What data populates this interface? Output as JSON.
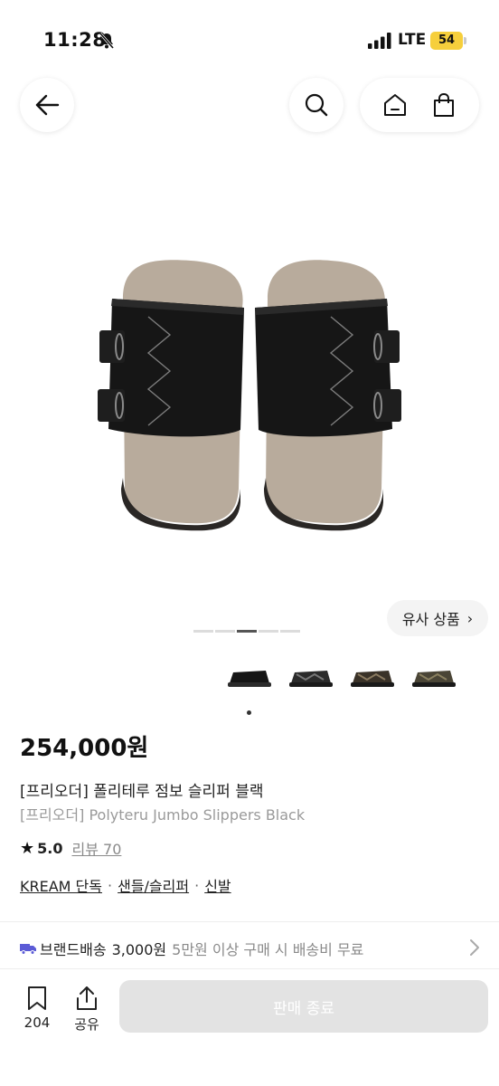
{
  "status_bar": {
    "time": "11:28",
    "network": "LTE",
    "battery": "54"
  },
  "nav": {
    "back_icon": "arrow-left-icon",
    "search_icon": "search-icon",
    "home_icon": "home-icon",
    "cart_icon": "shopping-bag-icon"
  },
  "gallery": {
    "similar_label": "유사 상품",
    "indicator_count": 5,
    "active_index": 2
  },
  "product": {
    "price": "254,000원",
    "name_ko": "[프리오더] 폴리테루 점보 슬리퍼 블랙",
    "name_en": "[프리오더] Polyteru Jumbo Slippers Black",
    "rating": "5.0",
    "review": "리뷰 70",
    "tags": [
      "KREAM 단독",
      "샌들/슬리퍼",
      "신발"
    ]
  },
  "shipping": {
    "label": "브랜드배송",
    "fee": "3,000원",
    "note": "5만원 이상 구매 시 배송비 무료"
  },
  "bottom": {
    "bookmark_count": "204",
    "share_label": "공유",
    "cta_label": "판매 종료"
  },
  "colors": {
    "accent": "#111111",
    "muted": "#9a9a9a",
    "disabled_btn": "#e3e3e3",
    "battery": "#f6cf3c"
  }
}
